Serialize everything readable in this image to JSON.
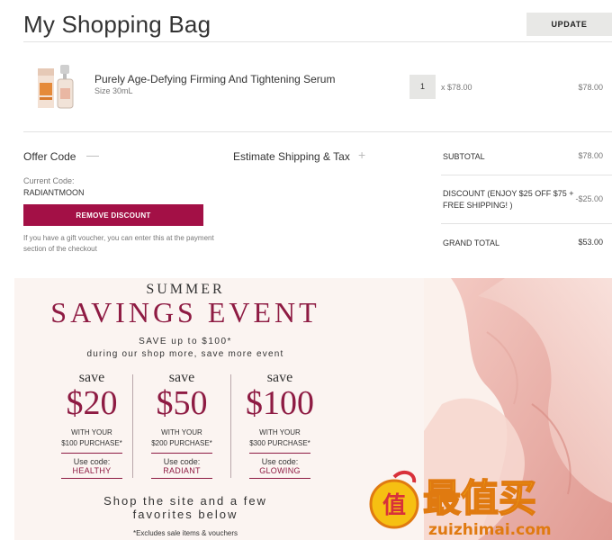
{
  "header": {
    "title": "My Shopping Bag",
    "update_label": "UPDATE"
  },
  "cart": {
    "items": [
      {
        "name": "Purely Age-Defying Firming And Tightening Serum",
        "size": "Size 30mL",
        "quantity": "1",
        "unit_price": "x $78.00",
        "line_total": "$78.00"
      }
    ]
  },
  "offer": {
    "title": "Offer Code",
    "toggle": "—",
    "current_label": "Current Code:",
    "current_code": "RADIANTMOON",
    "remove_label": "REMOVE DISCOUNT",
    "note": "If you have a gift voucher, you can enter this at the payment section of the checkout"
  },
  "shipping": {
    "title": "Estimate Shipping & Tax",
    "toggle": "+"
  },
  "totals": {
    "subtotal_label": "SUBTOTAL",
    "subtotal": "$78.00",
    "discount_label": "DISCOUNT (ENJOY $25 OFF $75 + FREE SHIPPING! )",
    "discount": "-$25.00",
    "grand_label": "GRAND TOTAL",
    "grand": "$53.00"
  },
  "banner": {
    "summer": "SUMMER",
    "headline": "SAVINGS EVENT",
    "save_up": "SAVE up to $100*",
    "during": "during our shop more, save more event",
    "tiers": [
      {
        "save": "save",
        "amount": "$20",
        "with": "WITH YOUR",
        "purchase": "$100 PURCHASE*",
        "use": "Use code:",
        "code": "HEALTHY"
      },
      {
        "save": "save",
        "amount": "$50",
        "with": "WITH YOUR",
        "purchase": "$200 PURCHASE*",
        "use": "Use code:",
        "code": "RADIANT"
      },
      {
        "save": "save",
        "amount": "$100",
        "with": "WITH YOUR",
        "purchase": "$300 PURCHASE*",
        "use": "Use code:",
        "code": "GLOWING"
      }
    ],
    "shop_line1": "Shop the site and a few",
    "shop_line2": "favorites below",
    "exclusions": "*Excludes sale items & vouchers"
  },
  "watermark": {
    "text_cn": "最值买",
    "text_url": "zuizhimai.com",
    "badge": "值"
  },
  "colors": {
    "brand": "#a31046",
    "accent_text": "#8e1b43",
    "button_gray": "#e8e8e6",
    "banner_bg": "#fbf4f1"
  }
}
